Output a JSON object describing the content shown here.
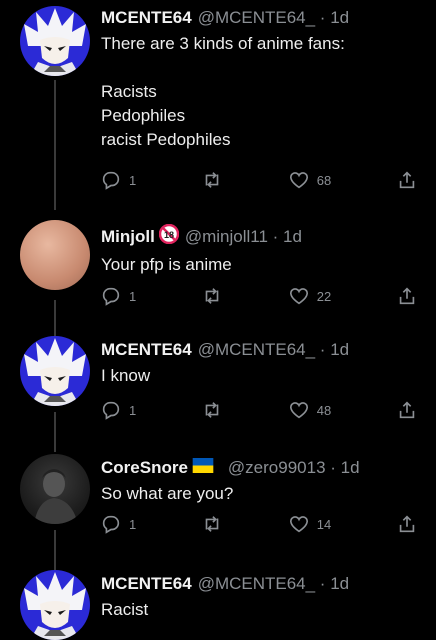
{
  "tweets": [
    {
      "name": "MCENTE64",
      "handle": "@MCENTE64_ · 1d",
      "body": [
        "There are 3 kinds of anime fans:",
        "",
        "Racists",
        "Pedophiles",
        "racist Pedophiles"
      ],
      "replies": "1",
      "likes": "68",
      "avatar": "anime-character-avatar"
    },
    {
      "name": "Minjoll",
      "handle": "@minjoll11 · 1d",
      "badge": "18",
      "body": [
        "Your pfp is anime"
      ],
      "replies": "1",
      "likes": "22",
      "avatar": "skin-tone-circle-avatar"
    },
    {
      "name": "MCENTE64",
      "handle": "@MCENTE64_ · 1d",
      "body": [
        "I know"
      ],
      "replies": "1",
      "likes": "48",
      "avatar": "anime-character-avatar"
    },
    {
      "name": "CoreSnore",
      "handle": "@zero99013 · 1d",
      "flag": "ukraine-flag",
      "body": [
        "So what are you?"
      ],
      "replies": "1",
      "likes": "14",
      "avatar": "person-photo-avatar"
    },
    {
      "name": "MCENTE64",
      "handle": "@MCENTE64_ · 1d",
      "body": [
        "Racist"
      ],
      "avatar": "anime-character-avatar"
    }
  ],
  "colors": {
    "background": "#000000",
    "text": "#e7e9ea",
    "muted": "#8b8f94",
    "avatar_purple": "#2b2ad6",
    "badge_red": "#e0245e",
    "flag_blue": "#0057b7",
    "flag_yellow": "#ffd700"
  }
}
